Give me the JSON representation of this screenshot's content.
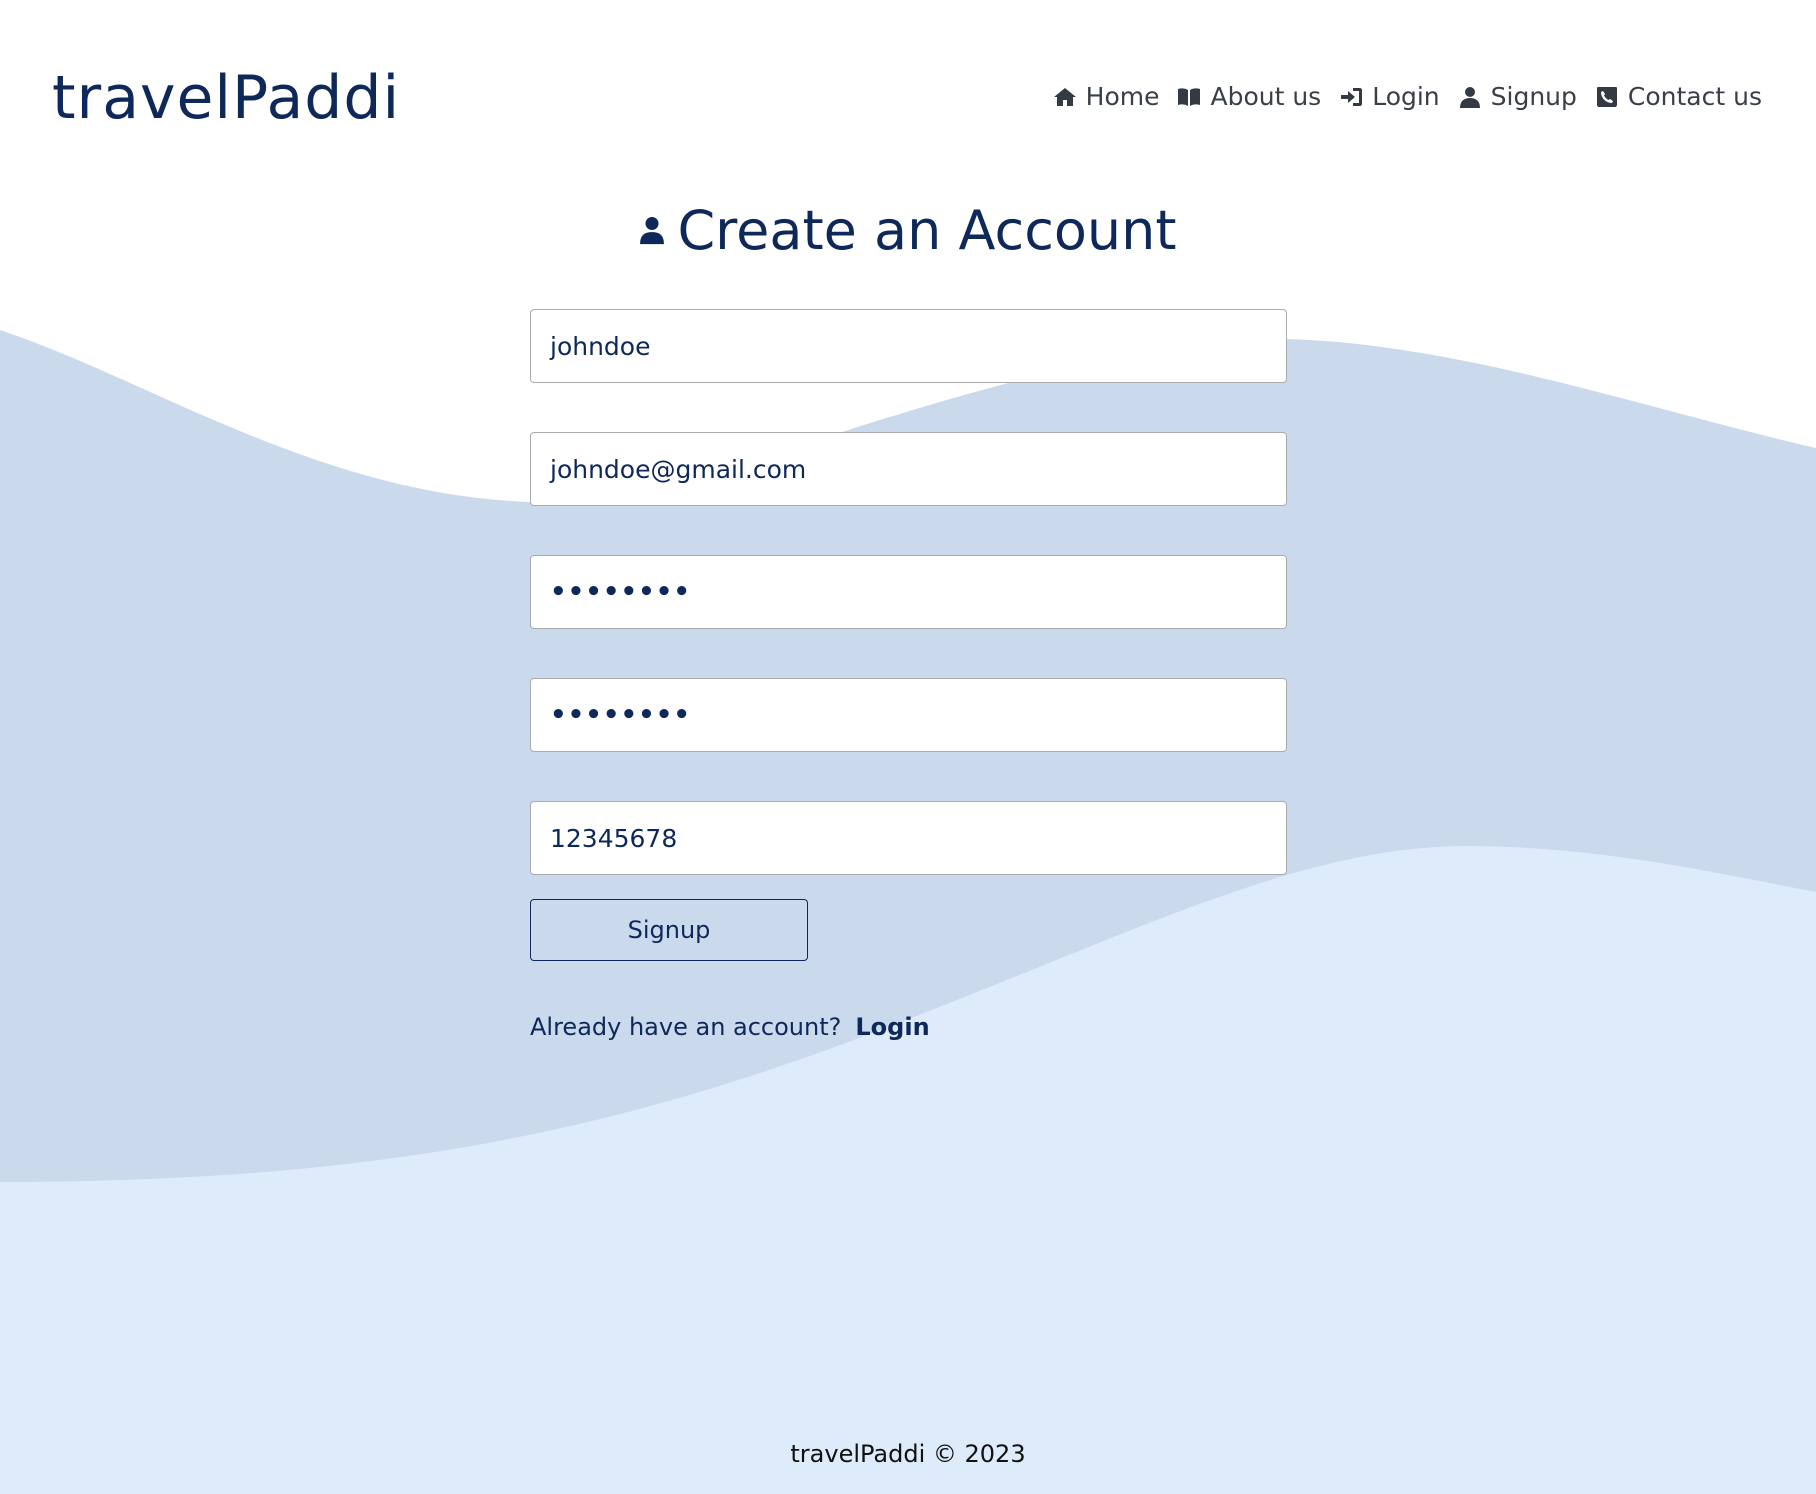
{
  "brand": {
    "logo": "travelPaddi"
  },
  "nav": {
    "items": [
      {
        "label": "Home",
        "icon": "home-icon"
      },
      {
        "label": "About us",
        "icon": "book-icon"
      },
      {
        "label": "Login",
        "icon": "sign-in-icon"
      },
      {
        "label": "Signup",
        "icon": "user-icon"
      },
      {
        "label": "Contact us",
        "icon": "phone-icon"
      }
    ]
  },
  "page": {
    "title": "Create an Account",
    "title_icon": "user-icon"
  },
  "form": {
    "fields": [
      {
        "name": "username",
        "value": "johndoe"
      },
      {
        "name": "email",
        "value": "johndoe@gmail.com"
      },
      {
        "name": "password",
        "value": "••••••••"
      },
      {
        "name": "confirm_password",
        "value": "••••••••"
      },
      {
        "name": "phone",
        "value": "12345678"
      }
    ],
    "submit_label": "Signup",
    "already_text": "Already have an account?",
    "login_link": "Login"
  },
  "footer": {
    "text": "travelPaddi © 2023"
  },
  "colors": {
    "brand": "#0d2859",
    "wave_dark": "#cbd9ec",
    "wave_light": "#deebfa",
    "nav_text": "#3a3f47"
  }
}
